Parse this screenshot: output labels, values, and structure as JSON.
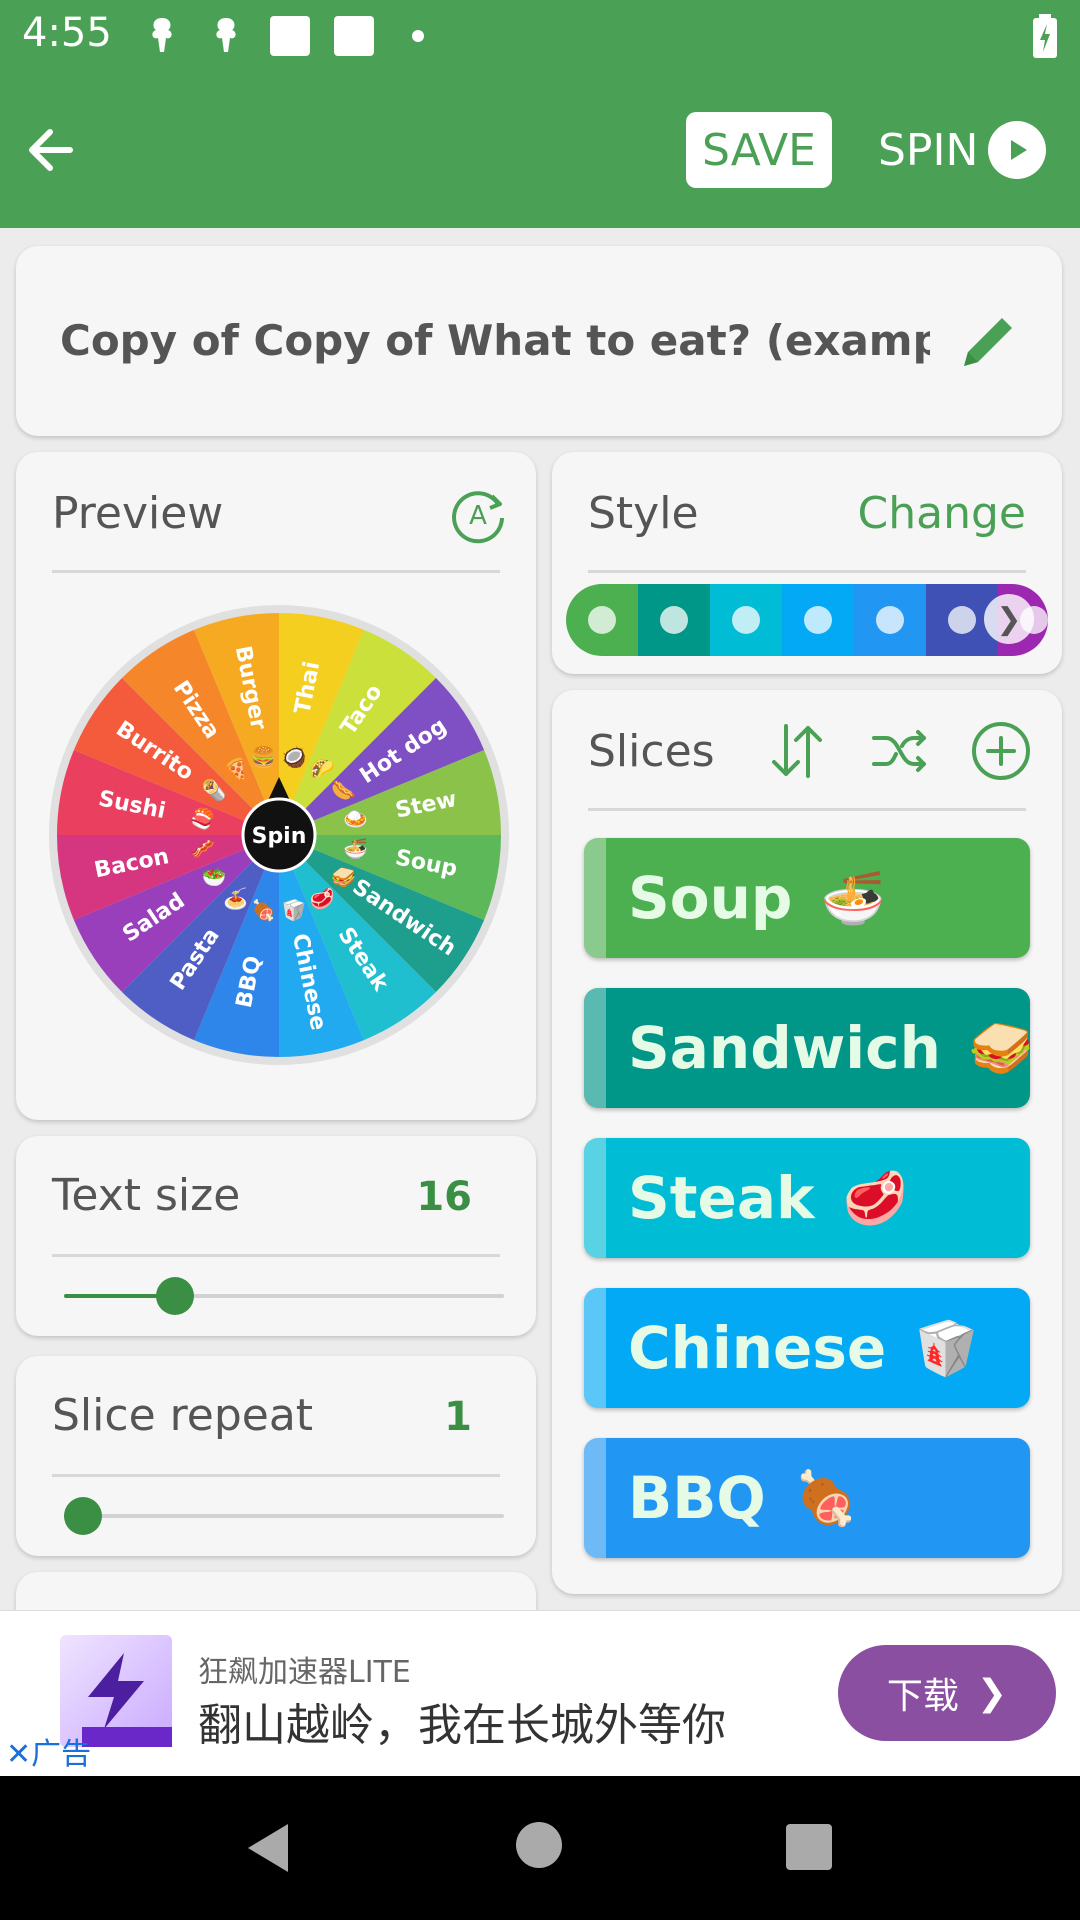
{
  "status_bar": {
    "time": "4:55"
  },
  "toolbar": {
    "save_label": "SAVE",
    "spin_label": "SPIN"
  },
  "wheel_title": "Copy of Copy of What to eat? (example)",
  "preview": {
    "heading": "Preview",
    "center_label": "Spin"
  },
  "wheel_slices": [
    {
      "label": "Thai",
      "emoji": "🥥",
      "color": "#f4cf20"
    },
    {
      "label": "Taco",
      "emoji": "🌮",
      "color": "#cbe03a"
    },
    {
      "label": "Hot dog",
      "emoji": "🌭",
      "color": "#7f4fc4"
    },
    {
      "label": "Stew",
      "emoji": "🍛",
      "color": "#8bc34a"
    },
    {
      "label": "Soup",
      "emoji": "🍜",
      "color": "#5db85a"
    },
    {
      "label": "Sandwich",
      "emoji": "🥪",
      "color": "#1e9e8c"
    },
    {
      "label": "Steak",
      "emoji": "🥩",
      "color": "#1fbfcf"
    },
    {
      "label": "Chinese",
      "emoji": "🥡",
      "color": "#22aaf0"
    },
    {
      "label": "BBQ",
      "emoji": "🍖",
      "color": "#2f86ea"
    },
    {
      "label": "Pasta",
      "emoji": "🍝",
      "color": "#4f5ec4"
    },
    {
      "label": "Salad",
      "emoji": "🥗",
      "color": "#9a3fbb"
    },
    {
      "label": "Bacon",
      "emoji": "🥓",
      "color": "#d6357f"
    },
    {
      "label": "Sushi",
      "emoji": "🍣",
      "color": "#ea3f5f"
    },
    {
      "label": "Burrito",
      "emoji": "🌯",
      "color": "#f45a3c"
    },
    {
      "label": "Pizza",
      "emoji": "🍕",
      "color": "#f6862a"
    },
    {
      "label": "Burger",
      "emoji": "🍔",
      "color": "#f6aa22"
    }
  ],
  "text_size": {
    "label": "Text size",
    "value": "16",
    "fraction": 0.23
  },
  "slice_repeat": {
    "label": "Slice repeat",
    "value": "1",
    "fraction": 0.0
  },
  "style": {
    "heading": "Style",
    "change_label": "Change",
    "swatches": [
      "#4caf50",
      "#009688",
      "#00bcd4",
      "#03a9f4",
      "#2196f3",
      "#3f51b5",
      "#9c27b0"
    ]
  },
  "slices": {
    "heading": "Slices",
    "items": [
      {
        "name": "Soup",
        "emoji": "🍜",
        "color": "#4caf50"
      },
      {
        "name": "Sandwich",
        "emoji": "🥪",
        "color": "#009688"
      },
      {
        "name": "Steak",
        "emoji": "🥩",
        "color": "#00bcd4"
      },
      {
        "name": "Chinese",
        "emoji": "🥡",
        "color": "#03a9f4"
      },
      {
        "name": "BBQ",
        "emoji": "🍖",
        "color": "#2196f3"
      }
    ]
  },
  "ad": {
    "app_name": "狂飙加速器LITE",
    "tagline": "翻山越岭，我在长城外等你",
    "ad_label": "广告",
    "download_label": "下载"
  }
}
